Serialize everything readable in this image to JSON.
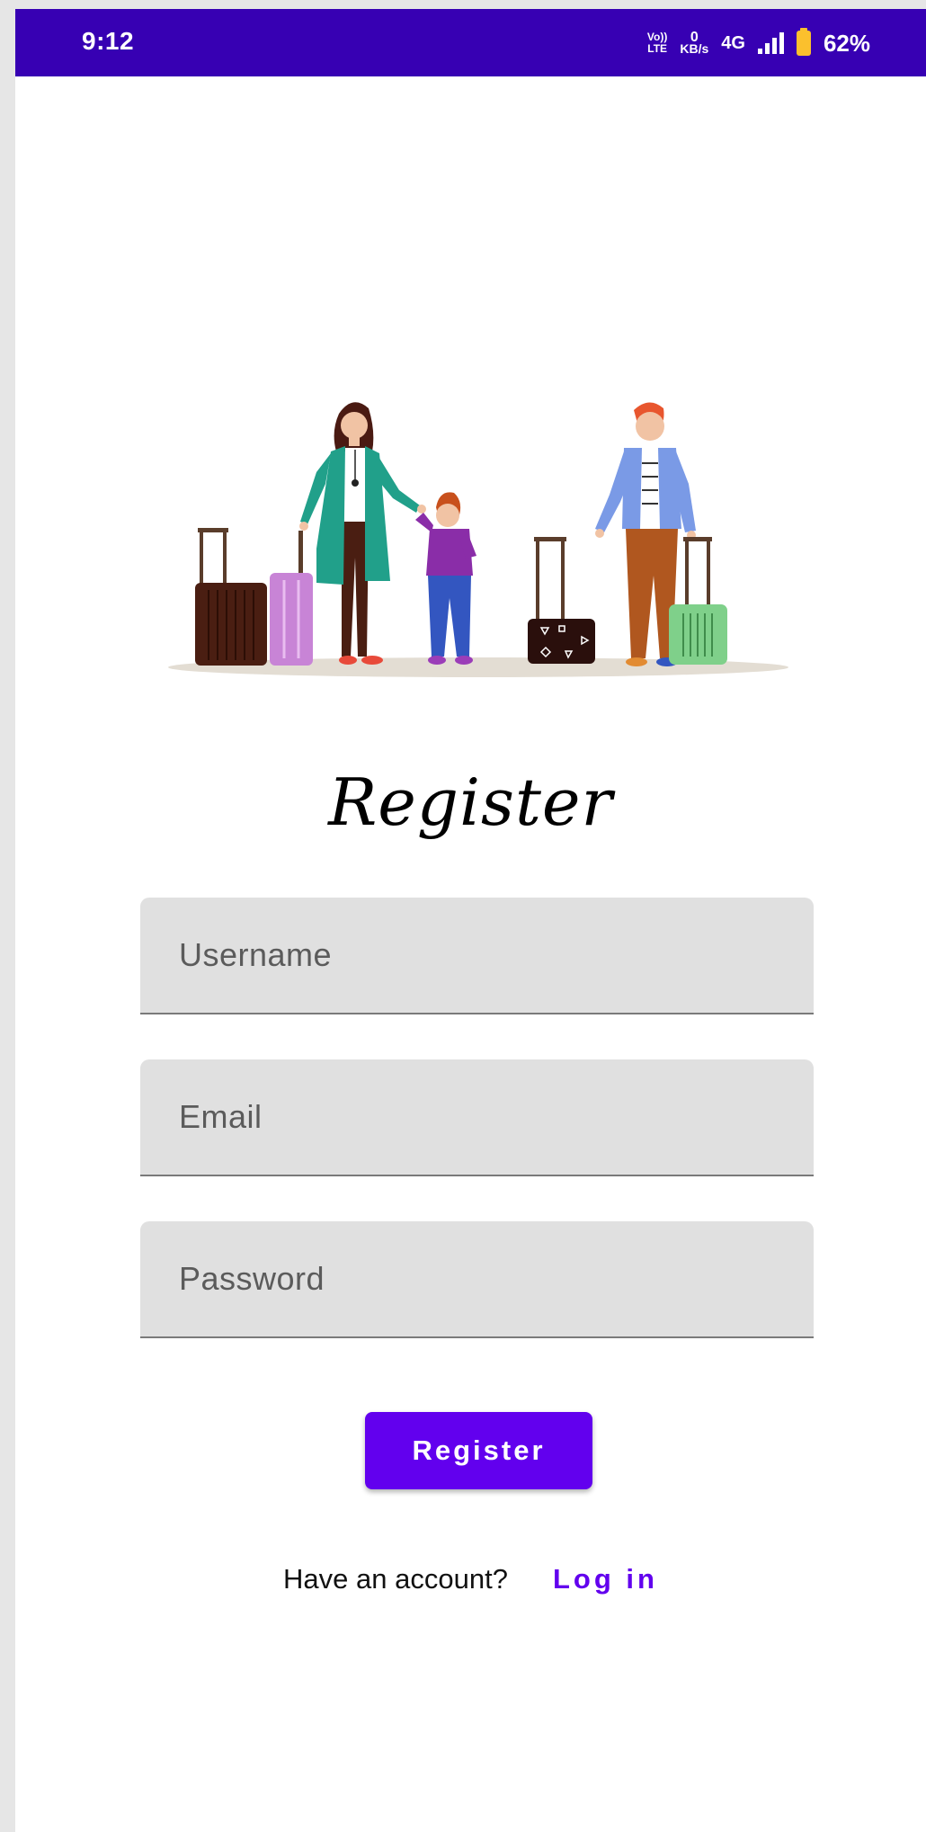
{
  "status_bar": {
    "time": "9:12",
    "volte_top": "Vo))",
    "volte_bottom": "LTE",
    "data_rate_value": "0",
    "data_rate_unit": "KB/s",
    "network": "4G",
    "battery": "62%",
    "icons": [
      "volte-icon",
      "signal-icon",
      "battery-icon"
    ]
  },
  "illustration": {
    "icon": "family-travel-illustration"
  },
  "form": {
    "title": "Register",
    "username_placeholder": "Username",
    "email_placeholder": "Email",
    "password_placeholder": "Password",
    "submit_label": "Register"
  },
  "footer": {
    "prompt": "Have an account?",
    "login_label": "Log in"
  },
  "colors": {
    "status_bar": "#3700b3",
    "primary": "#6200ee",
    "field_bg": "#e0e0e0",
    "battery": "#fbc02d"
  }
}
